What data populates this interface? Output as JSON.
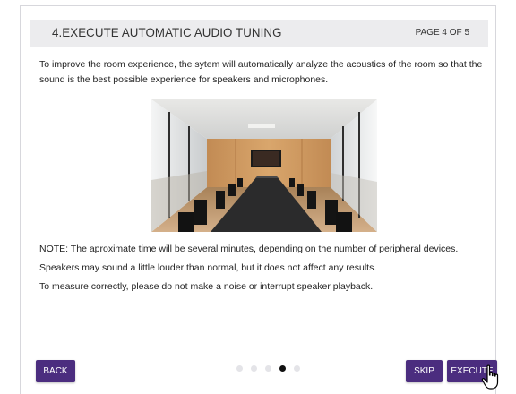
{
  "wizard": {
    "title": "4.EXECUTE AUTOMATIC AUDIO TUNING",
    "page_indicator": "PAGE 4 OF 5",
    "intro_text": "To improve the room experience, the sytem will automatically analyze the acoustics of the room so that the sound is the best possible experience for speakers and microphones.",
    "notes": [
      "NOTE: The aproximate time will be several minutes, depending on the number of peripheral devices.",
      "Speakers may sound a little louder than normal, but it does not affect any results.",
      "To measure correctly, please do not make a noise or interrupt speaker playback."
    ],
    "buttons": {
      "back_label": "BACK",
      "skip_label": "SKIP",
      "execute_label": "EXECUTE"
    },
    "pagination": {
      "total": 5,
      "current": 4
    }
  },
  "colors": {
    "accent": "#4b2d7f",
    "header_bg": "#ececee",
    "active_dot": "#111111",
    "inactive_dot": "#e4e4e8"
  },
  "icons": {
    "cursor": "hand-pointer-icon"
  }
}
